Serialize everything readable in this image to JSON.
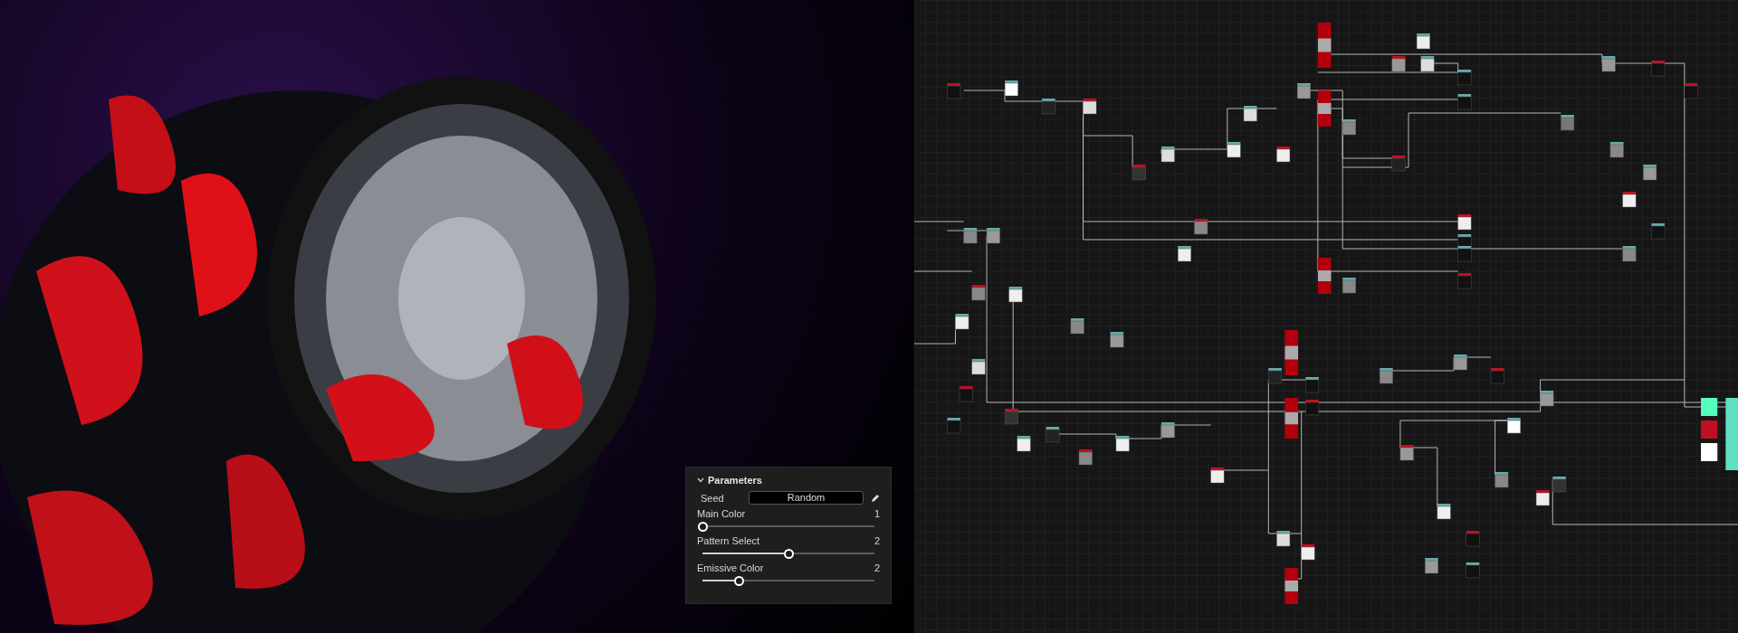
{
  "parameters_panel": {
    "title": "Parameters",
    "expanded": true,
    "seed": {
      "label": "Seed",
      "button": "Random"
    },
    "sliders": [
      {
        "label": "Main Color",
        "value": "1",
        "level": 0
      },
      {
        "label": "Pattern Select",
        "value": "2",
        "level": 0.5
      },
      {
        "label": "Emissive Color",
        "value": "2",
        "level": 0.21
      }
    ]
  }
}
